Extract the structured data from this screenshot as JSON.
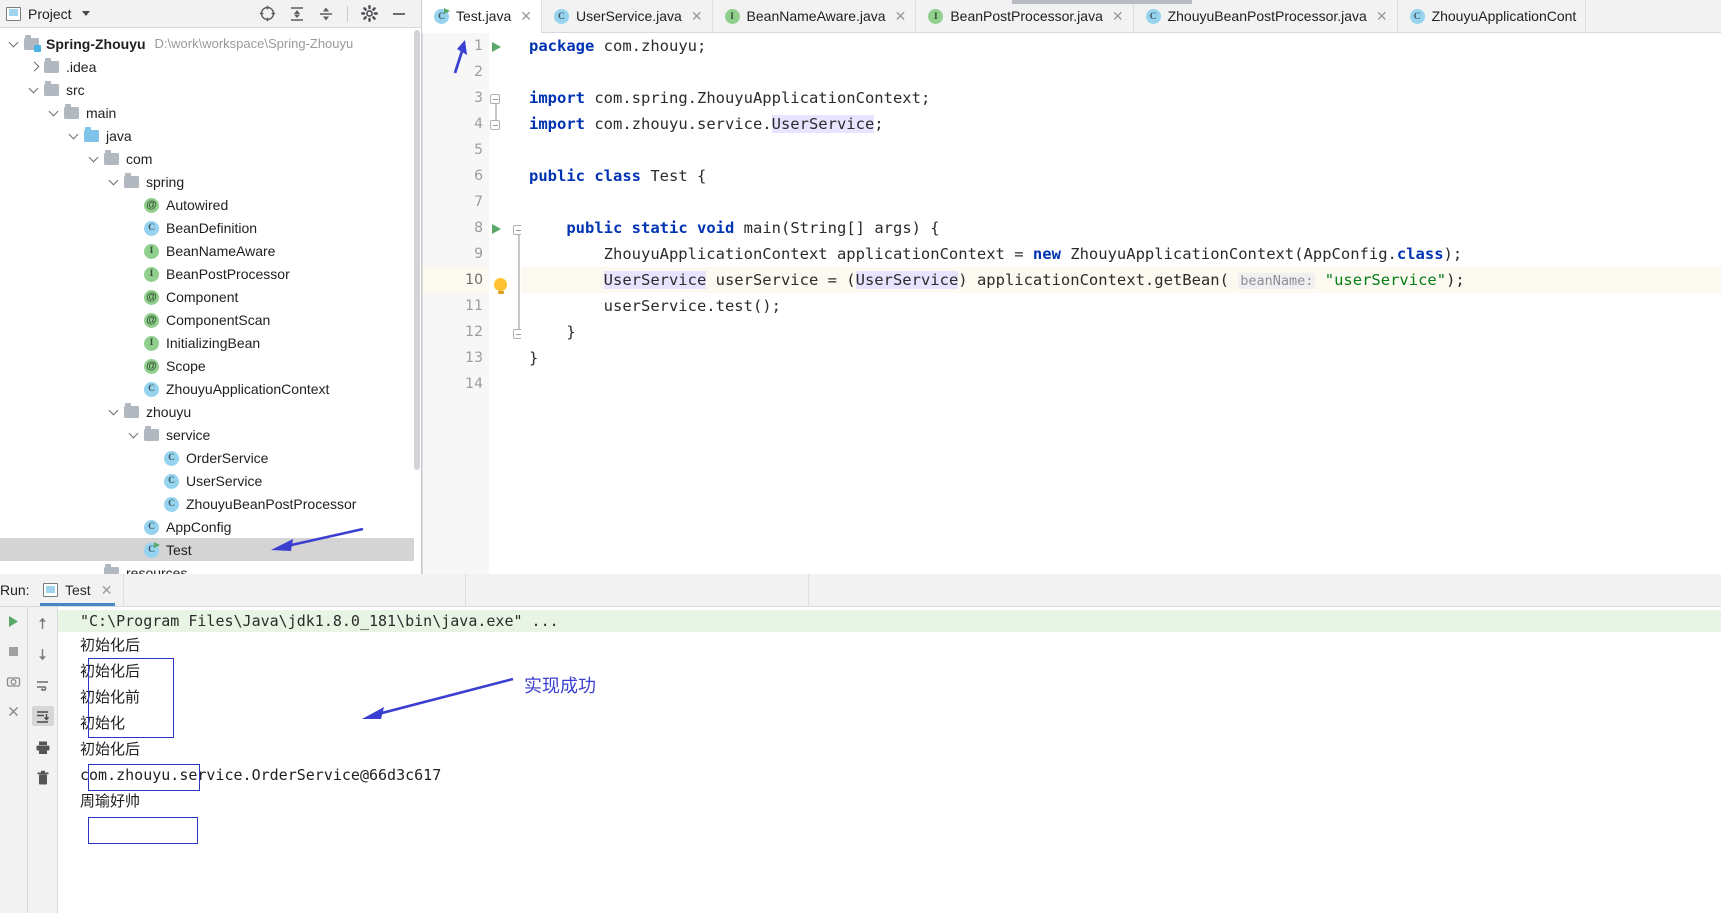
{
  "project_panel": {
    "title": "Project",
    "icons": [
      "locate-icon",
      "expand-all-icon",
      "collapse-all-icon",
      "gear-icon",
      "hide-icon"
    ],
    "tree": [
      {
        "label": "Spring-Zhouyu",
        "path": "D:\\work\\workspace\\Spring-Zhouyu",
        "icon": "module-folder-icon",
        "depth": 0,
        "twisty": "down",
        "bold": true
      },
      {
        "label": ".idea",
        "path": "",
        "icon": "folder-icon",
        "depth": 1,
        "twisty": "right",
        "bold": false
      },
      {
        "label": "src",
        "path": "",
        "icon": "folder-icon",
        "depth": 1,
        "twisty": "down",
        "bold": false
      },
      {
        "label": "main",
        "path": "",
        "icon": "folder-icon",
        "depth": 2,
        "twisty": "down",
        "bold": false
      },
      {
        "label": "java",
        "path": "",
        "icon": "source-folder-icon",
        "depth": 3,
        "twisty": "down",
        "bold": false
      },
      {
        "label": "com",
        "path": "",
        "icon": "folder-icon",
        "depth": 4,
        "twisty": "down",
        "bold": false
      },
      {
        "label": "spring",
        "path": "",
        "icon": "folder-icon",
        "depth": 5,
        "twisty": "down",
        "bold": false
      },
      {
        "label": "Autowired",
        "path": "",
        "icon": "annotation-icon",
        "depth": 6,
        "twisty": "",
        "bold": false
      },
      {
        "label": "BeanDefinition",
        "path": "",
        "icon": "class-icon",
        "depth": 6,
        "twisty": "",
        "bold": false
      },
      {
        "label": "BeanNameAware",
        "path": "",
        "icon": "interface-icon",
        "depth": 6,
        "twisty": "",
        "bold": false
      },
      {
        "label": "BeanPostProcessor",
        "path": "",
        "icon": "interface-icon",
        "depth": 6,
        "twisty": "",
        "bold": false
      },
      {
        "label": "Component",
        "path": "",
        "icon": "annotation-icon",
        "depth": 6,
        "twisty": "",
        "bold": false
      },
      {
        "label": "ComponentScan",
        "path": "",
        "icon": "annotation-icon",
        "depth": 6,
        "twisty": "",
        "bold": false
      },
      {
        "label": "InitializingBean",
        "path": "",
        "icon": "interface-icon",
        "depth": 6,
        "twisty": "",
        "bold": false
      },
      {
        "label": "Scope",
        "path": "",
        "icon": "annotation-icon",
        "depth": 6,
        "twisty": "",
        "bold": false
      },
      {
        "label": "ZhouyuApplicationContext",
        "path": "",
        "icon": "class-icon",
        "depth": 6,
        "twisty": "",
        "bold": false
      },
      {
        "label": "zhouyu",
        "path": "",
        "icon": "folder-icon",
        "depth": 5,
        "twisty": "down",
        "bold": false
      },
      {
        "label": "service",
        "path": "",
        "icon": "folder-icon",
        "depth": 6,
        "twisty": "down",
        "bold": false
      },
      {
        "label": "OrderService",
        "path": "",
        "icon": "class-icon",
        "depth": 7,
        "twisty": "",
        "bold": false
      },
      {
        "label": "UserService",
        "path": "",
        "icon": "class-icon",
        "depth": 7,
        "twisty": "",
        "bold": false
      },
      {
        "label": "ZhouyuBeanPostProcessor",
        "path": "",
        "icon": "class-icon",
        "depth": 7,
        "twisty": "",
        "bold": false
      },
      {
        "label": "AppConfig",
        "path": "",
        "icon": "class-icon",
        "depth": 6,
        "twisty": "",
        "bold": false
      },
      {
        "label": "Test",
        "path": "",
        "icon": "runnable-class-icon",
        "depth": 6,
        "twisty": "",
        "bold": false,
        "selected": true
      },
      {
        "label": "resources",
        "path": "",
        "icon": "folder-icon",
        "depth": 4,
        "twisty": "",
        "bold": false
      }
    ]
  },
  "editor": {
    "tabs": [
      {
        "label": "Test.java",
        "icon": "runnable-class-icon",
        "active": true,
        "closable": true
      },
      {
        "label": "UserService.java",
        "icon": "class-icon",
        "active": false,
        "closable": true
      },
      {
        "label": "BeanNameAware.java",
        "icon": "interface-icon",
        "active": false,
        "closable": true
      },
      {
        "label": "BeanPostProcessor.java",
        "icon": "interface-icon",
        "active": false,
        "closable": true
      },
      {
        "label": "ZhouyuBeanPostProcessor.java",
        "icon": "class-icon",
        "active": false,
        "closable": true
      },
      {
        "label": "ZhouyuApplicationCont",
        "icon": "class-icon",
        "active": false,
        "closable": false
      }
    ],
    "line_numbers": [
      "1",
      "2",
      "3",
      "4",
      "5",
      "6",
      "7",
      "8",
      "9",
      "10",
      "11",
      "12",
      "13",
      "14"
    ],
    "current_line": 10,
    "lines": [
      {
        "n": 1,
        "text": "package com.zhouyu;"
      },
      {
        "n": 2,
        "text": ""
      },
      {
        "n": 3,
        "text": "import com.spring.ZhouyuApplicationContext;"
      },
      {
        "n": 4,
        "text": "import com.zhouyu.service.UserService;"
      },
      {
        "n": 5,
        "text": ""
      },
      {
        "n": 6,
        "text": "public class Test {"
      },
      {
        "n": 7,
        "text": ""
      },
      {
        "n": 8,
        "text": "    public static void main(String[] args) {"
      },
      {
        "n": 9,
        "text": "        ZhouyuApplicationContext applicationContext = new ZhouyuApplicationContext(AppConfig.class);"
      },
      {
        "n": 10,
        "text": "        UserService userService = (UserService) applicationContext.getBean( beanName: \"userService\");"
      },
      {
        "n": 11,
        "text": "        userService.test();"
      },
      {
        "n": 12,
        "text": "    }"
      },
      {
        "n": 13,
        "text": "}"
      },
      {
        "n": 14,
        "text": ""
      }
    ],
    "parameter_hint": "beanName:",
    "string_literal": "\"userService\""
  },
  "run_window": {
    "label": "Run:",
    "tab_label": "Test",
    "toolbar_icons": [
      "rerun-icon",
      "stop-icon",
      "camera-icon",
      "close-icon"
    ],
    "toolbar2_icons": [
      "up-arrow-icon",
      "down-arrow-icon",
      "soft-wrap-icon",
      "scroll-to-end-icon",
      "print-icon",
      "trash-icon"
    ],
    "command_line": "\"C:\\Program Files\\Java\\jdk1.8.0_181\\bin\\java.exe\" ...",
    "output": [
      "初始化后",
      "初始化后",
      "初始化前",
      "初始化",
      "初始化后",
      "com.zhouyu.service.OrderService@66d3c617",
      "周瑜好帅"
    ]
  },
  "annotations": {
    "console_text": "实现成功",
    "accent_color": "#3b3fd1"
  }
}
